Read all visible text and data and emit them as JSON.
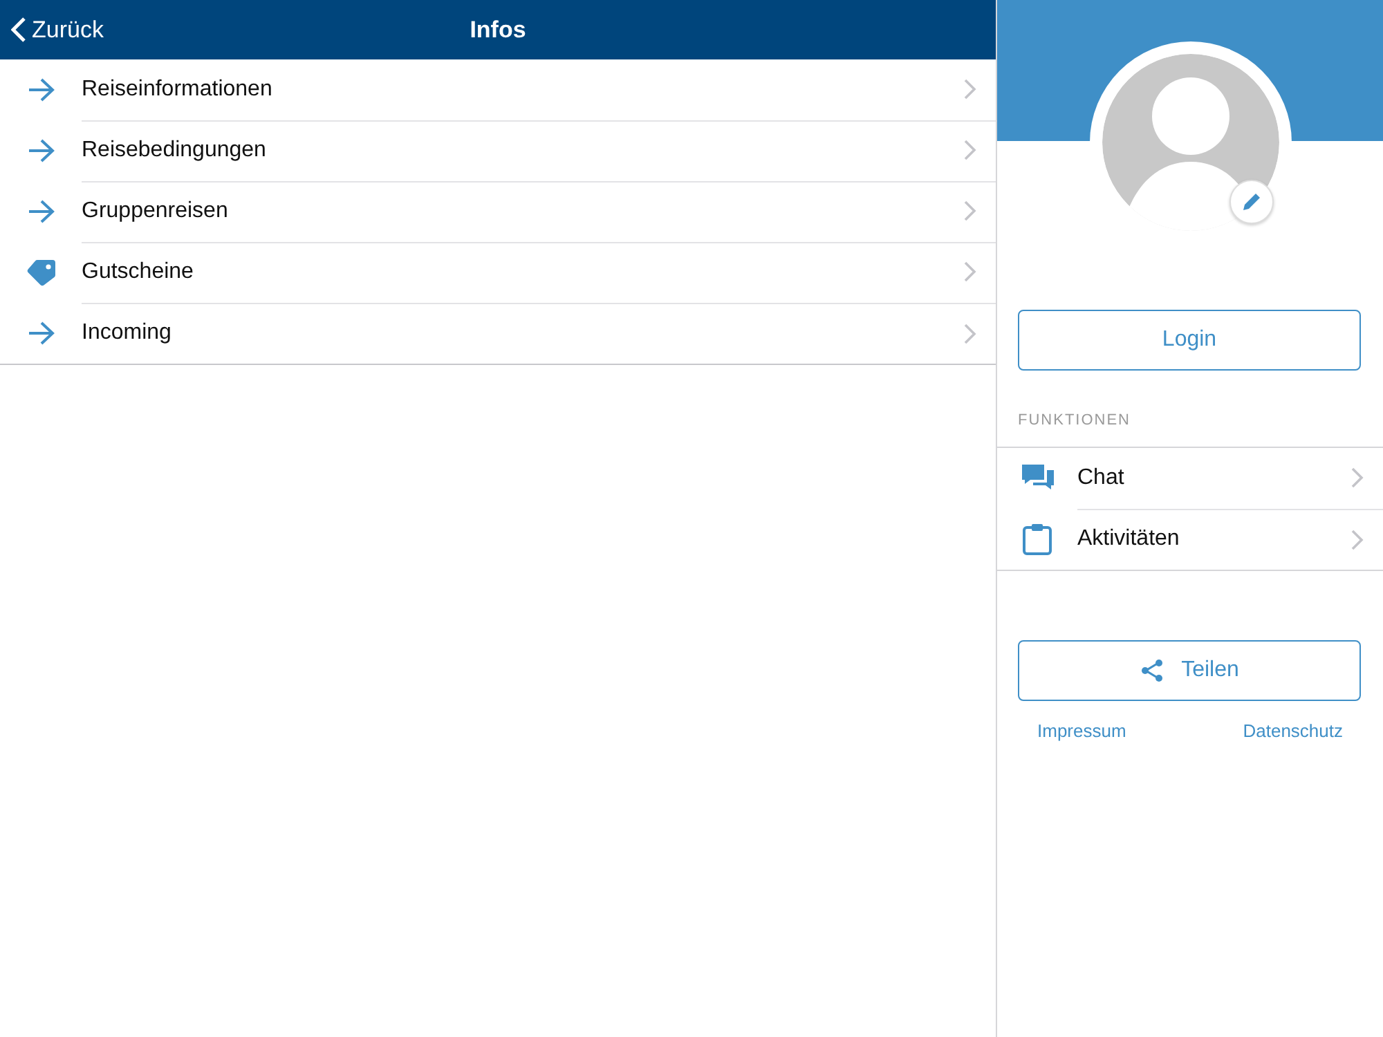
{
  "nav_bar": {
    "back_label": "Zurück",
    "title": "Infos"
  },
  "menu_items": [
    {
      "label": "Reiseinformationen",
      "kind": "arrow"
    },
    {
      "label": "Reisebedingungen",
      "kind": "arrow"
    },
    {
      "label": "Gruppenreisen",
      "kind": "arrow"
    },
    {
      "label": "Gutscheine",
      "kind": "tag"
    },
    {
      "label": "Incoming",
      "kind": "arrow"
    }
  ],
  "sidebar": {
    "login_button": "Login",
    "section_title": "FUNKTIONEN",
    "functions": [
      {
        "label": "Chat",
        "kind": "chat"
      },
      {
        "label": "Aktivitäten",
        "kind": "clipboard"
      }
    ],
    "share_button": "Teilen",
    "links": [
      "Impressum",
      "Datenschutz"
    ]
  }
}
